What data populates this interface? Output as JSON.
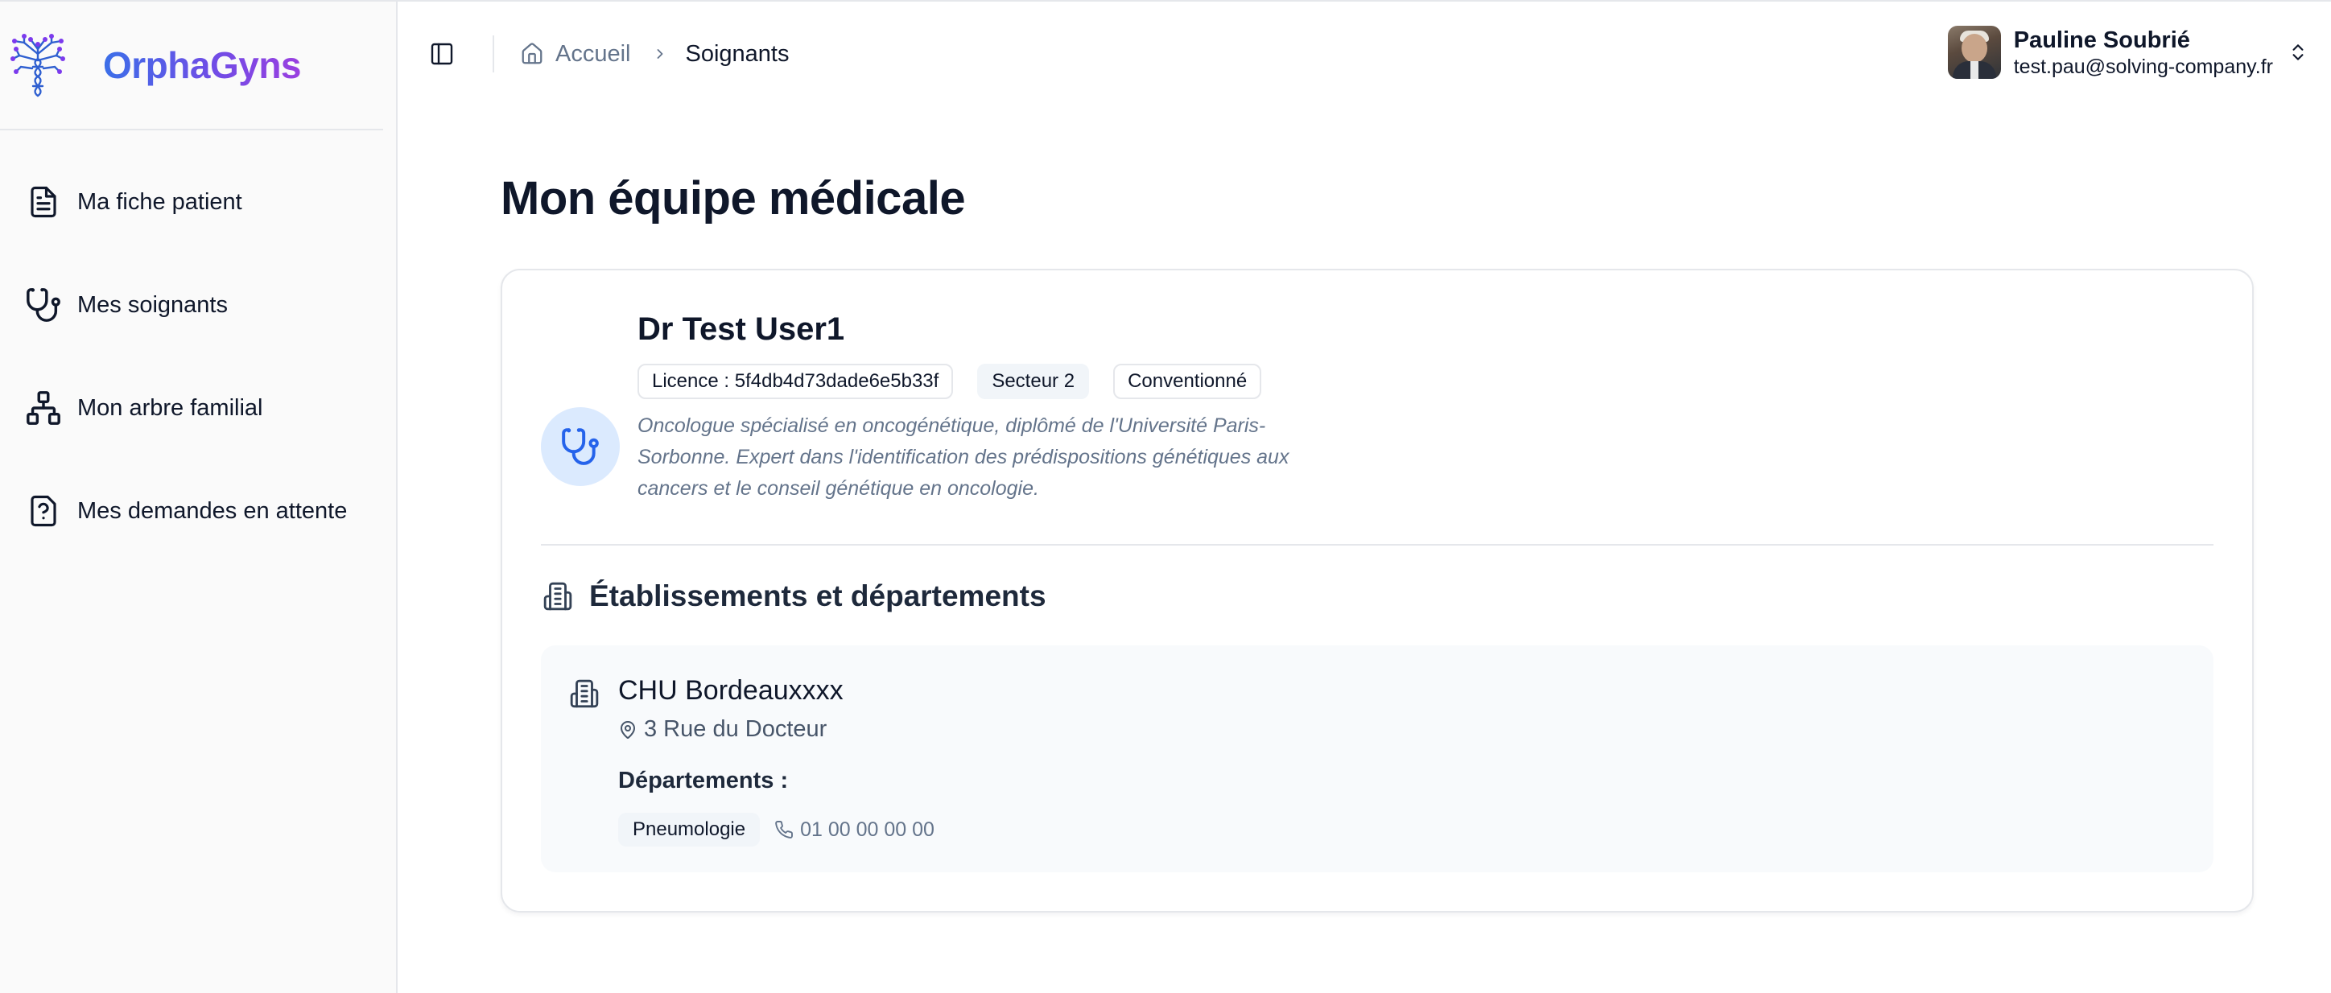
{
  "app": {
    "name": "OrphaGyns"
  },
  "sidebar": {
    "items": [
      {
        "label": "Ma fiche patient",
        "icon": "file-text-icon"
      },
      {
        "label": "Mes soignants",
        "icon": "stethoscope-icon"
      },
      {
        "label": "Mon arbre familial",
        "icon": "network-icon"
      },
      {
        "label": "Mes demandes en attente",
        "icon": "file-question-icon"
      }
    ]
  },
  "header": {
    "breadcrumb": {
      "home": "Accueil",
      "current": "Soignants"
    },
    "user": {
      "name": "Pauline Soubrié",
      "email": "test.pau@solving-company.fr"
    }
  },
  "main": {
    "title": "Mon équipe médicale",
    "doctor": {
      "name": "Dr Test User1",
      "license": "Licence : 5f4db4d73dade6e5b33f",
      "sector": "Secteur 2",
      "status": "Conventionné",
      "description": "Oncologue spécialisé en oncogénétique, diplômé de l'Université Paris-Sorbonne. Expert dans l'identification des prédispositions génétiques aux cancers et le conseil génétique en oncologie."
    },
    "establishments_title": "Établissements et départements",
    "establishment": {
      "name": "CHU Bordeauxxxx",
      "address": "3 Rue du Docteur",
      "departments_label": "Départements :",
      "departments": [
        {
          "name": "Pneumologie",
          "phone": "01 00 00 00 00"
        }
      ]
    }
  },
  "colors": {
    "accent": "#2563eb",
    "brand_start": "#3b6fe8",
    "brand_end": "#9a3fe0",
    "icon_bg": "#dbeafe"
  }
}
